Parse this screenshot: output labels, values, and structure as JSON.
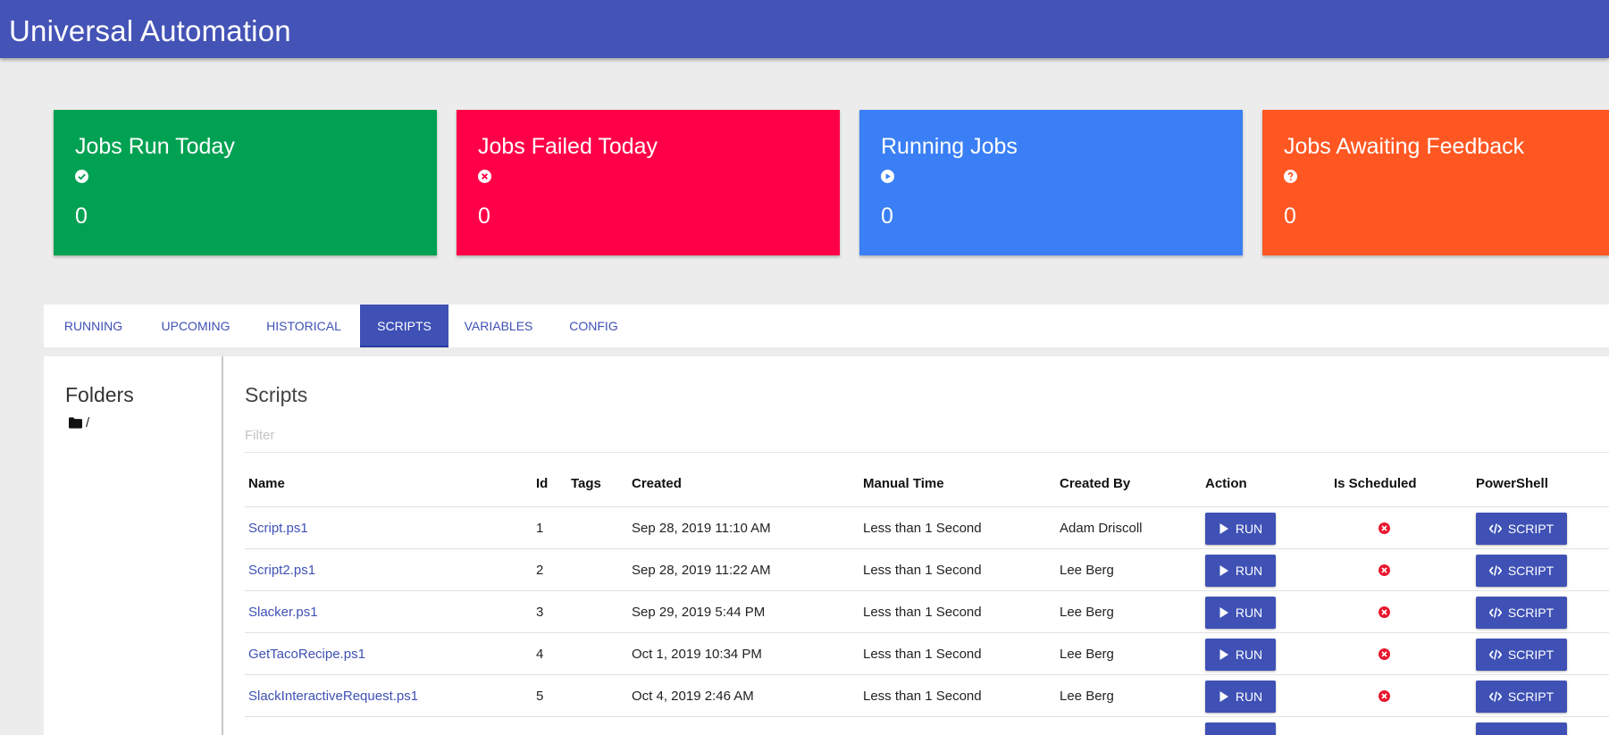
{
  "app": {
    "title": "Universal Automation"
  },
  "colors": {
    "appbar": "#4453b6",
    "accent": "#3f51b5",
    "success": "#00a152",
    "danger": "#ff0048",
    "info": "#3a7ff5",
    "warning": "#ff5722",
    "error_icon": "#e8172f"
  },
  "cards": [
    {
      "title": "Jobs Run Today",
      "icon": "check-circle-icon",
      "value": "0",
      "color": "#00a152"
    },
    {
      "title": "Jobs Failed Today",
      "icon": "x-circle-icon",
      "value": "0",
      "color": "#ff0048"
    },
    {
      "title": "Running Jobs",
      "icon": "play-circle-icon",
      "value": "0",
      "color": "#3a7ff5"
    },
    {
      "title": "Jobs Awaiting Feedback",
      "icon": "question-circle-icon",
      "value": "0",
      "color": "#ff5722"
    }
  ],
  "tabs": [
    {
      "label": "RUNNING"
    },
    {
      "label": "UPCOMING"
    },
    {
      "label": "HISTORICAL"
    },
    {
      "label": "SCRIPTS",
      "active": true
    },
    {
      "label": "VARIABLES"
    },
    {
      "label": "CONFIG"
    }
  ],
  "folders": {
    "heading": "Folders",
    "items": [
      {
        "icon": "folder-icon",
        "label": "/"
      }
    ]
  },
  "scripts": {
    "heading": "Scripts",
    "filter_placeholder": "Filter",
    "columns": [
      "Name",
      "Id",
      "Tags",
      "Created",
      "Manual Time",
      "Created By",
      "Action",
      "Is Scheduled",
      "PowerShell"
    ],
    "run_label": "RUN",
    "script_label": "SCRIPT",
    "rows": [
      {
        "name": "Script.ps1",
        "id": "1",
        "tags": "",
        "created": "Sep 28, 2019 11:10 AM",
        "manual_time": "Less than 1 Second",
        "created_by": "Adam Driscoll",
        "is_scheduled": false
      },
      {
        "name": "Script2.ps1",
        "id": "2",
        "tags": "",
        "created": "Sep 28, 2019 11:22 AM",
        "manual_time": "Less than 1 Second",
        "created_by": "Lee Berg",
        "is_scheduled": false
      },
      {
        "name": "Slacker.ps1",
        "id": "3",
        "tags": "",
        "created": "Sep 29, 2019 5:44 PM",
        "manual_time": "Less than 1 Second",
        "created_by": "Lee Berg",
        "is_scheduled": false
      },
      {
        "name": "GetTacoRecipe.ps1",
        "id": "4",
        "tags": "",
        "created": "Oct 1, 2019 10:34 PM",
        "manual_time": "Less than 1 Second",
        "created_by": "Lee Berg",
        "is_scheduled": false
      },
      {
        "name": "SlackInteractiveRequest.ps1",
        "id": "5",
        "tags": "",
        "created": "Oct 4, 2019 2:46 AM",
        "manual_time": "Less than 1 Second",
        "created_by": "Lee Berg",
        "is_scheduled": false
      }
    ]
  }
}
